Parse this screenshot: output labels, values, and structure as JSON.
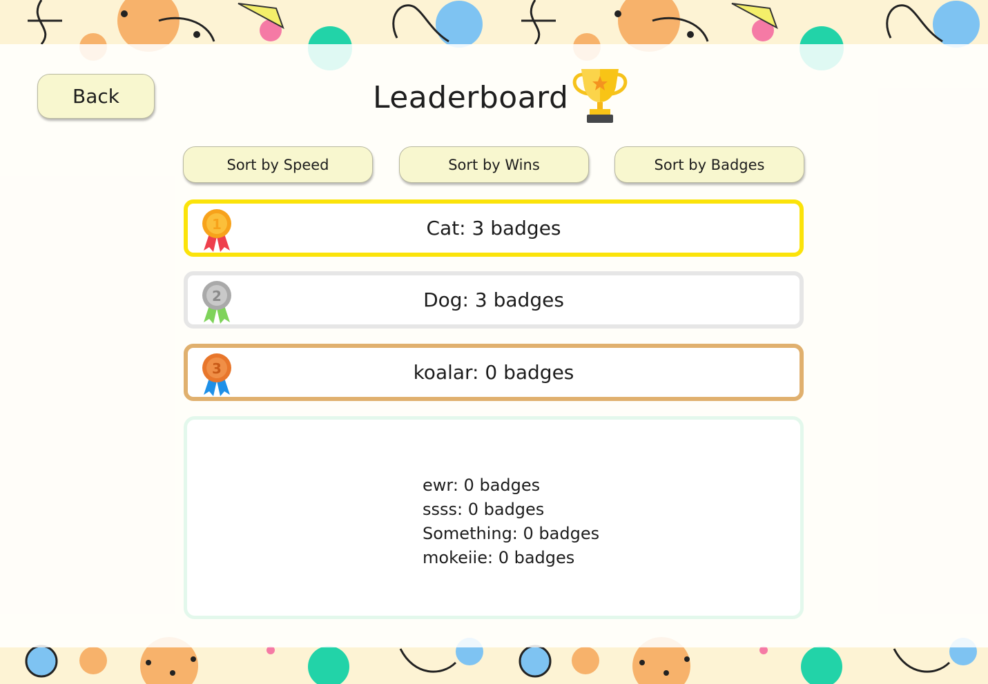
{
  "header": {
    "title": "Leaderboard",
    "trophy_icon": "trophy-icon",
    "back_label": "Back"
  },
  "sort_buttons": [
    {
      "label": "Sort by Speed"
    },
    {
      "label": "Sort by Wins"
    },
    {
      "label": "Sort by Badges"
    }
  ],
  "top_ranks": [
    {
      "rank": "1",
      "text": "Cat: 3 badges",
      "border_color": "#fbe30a",
      "medal_icon": "gold-medal-icon",
      "medal_color": "#f7a21b",
      "ribbon_color": "#ee3f4c"
    },
    {
      "rank": "2",
      "text": "Dog: 3 badges",
      "border_color": "#e6e6e6",
      "medal_icon": "silver-medal-icon",
      "medal_color": "#a9a9a9",
      "ribbon_color": "#7ed35a"
    },
    {
      "rank": "3",
      "text": "koalar: 0 badges",
      "border_color": "#e0b06e",
      "medal_icon": "bronze-medal-icon",
      "medal_color": "#e8762b",
      "ribbon_color": "#1e90e8"
    }
  ],
  "others": [
    {
      "text": "ewr: 0 badges"
    },
    {
      "text": "ssss: 0 badges"
    },
    {
      "text": "Something: 0 badges"
    },
    {
      "text": "mokeiie: 0 badges"
    }
  ],
  "colors": {
    "button_bg": "#f8f7cf",
    "page_bg": "#fdf3d4",
    "accent_green": "#22d3a8",
    "accent_blue": "#7ec3f2",
    "accent_orange": "#f7b26b",
    "accent_pink": "#f57aa5"
  }
}
